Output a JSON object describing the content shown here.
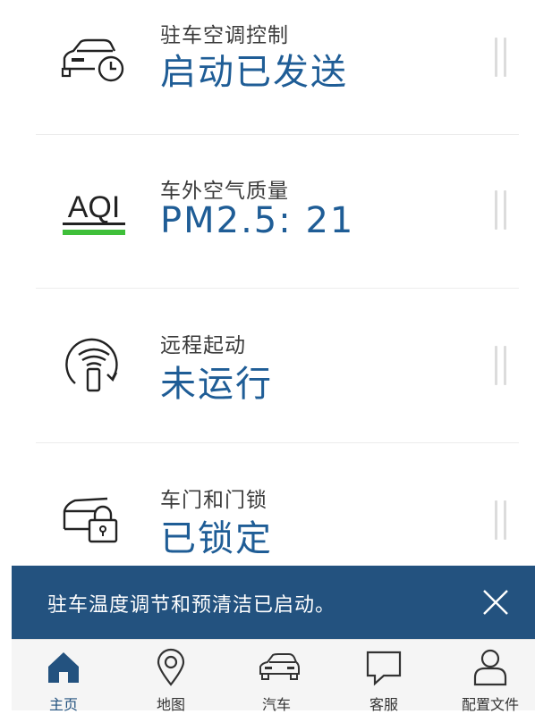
{
  "rows": [
    {
      "label": "驻车空调控制",
      "value": "启动已发送",
      "icon": "car-timer-icon"
    },
    {
      "label": "车外空气质量",
      "value": "PM2.5: 21",
      "icon": "aqi-icon"
    },
    {
      "label": "远程起动",
      "value": "未运行",
      "icon": "remote-start-icon"
    },
    {
      "label": "车门和门锁",
      "value": "已锁定",
      "icon": "door-lock-icon"
    }
  ],
  "aqi_text": "AQI",
  "banner": {
    "message": "驻车温度调节和预清洁已启动。"
  },
  "tabs": [
    {
      "label": "主页",
      "icon": "home-icon",
      "active": true
    },
    {
      "label": "地图",
      "icon": "map-pin-icon",
      "active": false
    },
    {
      "label": "汽车",
      "icon": "car-icon",
      "active": false
    },
    {
      "label": "客服",
      "icon": "chat-icon",
      "active": false
    },
    {
      "label": "配置文件",
      "icon": "profile-icon",
      "active": false
    }
  ],
  "colors": {
    "accent": "#1f5d96",
    "banner": "#23527f",
    "aqi_bar": "#3fbf3a"
  }
}
